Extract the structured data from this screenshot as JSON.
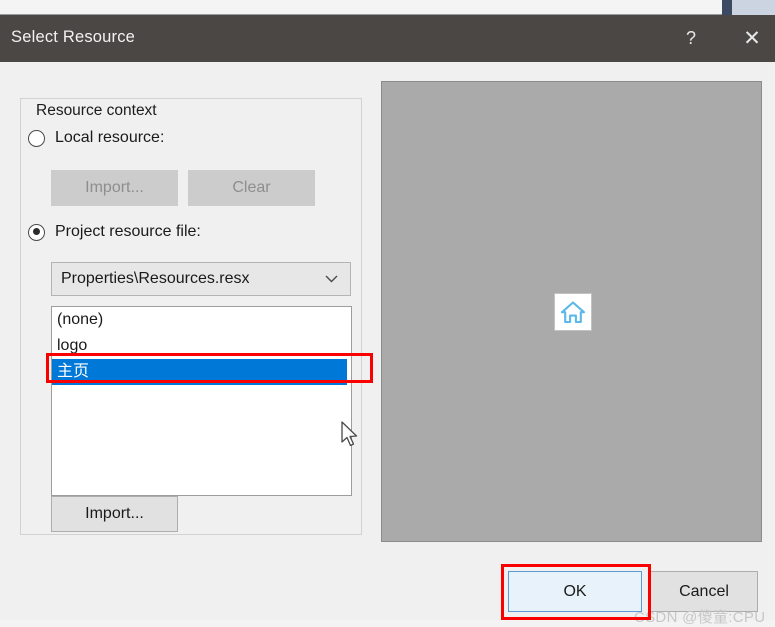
{
  "window": {
    "title": "Select Resource",
    "help_icon": "question-mark-icon",
    "close_icon": "close-x-icon"
  },
  "resource_context": {
    "group_label": "Resource context",
    "options": [
      {
        "label": "Local resource:",
        "selected": false
      },
      {
        "label": "Project resource file:",
        "selected": true
      }
    ],
    "local_buttons": [
      {
        "label": "Import...",
        "enabled": false
      },
      {
        "label": "Clear",
        "enabled": false
      }
    ],
    "combobox": {
      "value": "Properties\\Resources.resx",
      "arrow_icon": "chevron-down-icon"
    },
    "listbox": {
      "items": [
        {
          "label": "(none)",
          "selected": false
        },
        {
          "label": "logo",
          "selected": false
        },
        {
          "label": "主页",
          "selected": true
        }
      ]
    },
    "import_button": {
      "label": "Import..."
    }
  },
  "preview": {
    "image_alt": "home-icon",
    "background_color": "#aaaaaa",
    "icon_color": "#5bb8e8"
  },
  "footer": {
    "ok_label": "OK",
    "cancel_label": "Cancel"
  },
  "annotations": {
    "highlight_color": "#fb0000",
    "targets": [
      "selected-list-item",
      "ok-button"
    ]
  },
  "watermark": {
    "text": "CSDN @傻童:CPU"
  },
  "colors": {
    "titlebar": "#4a4744",
    "dialog_background": "#f0f0f0",
    "selection_blue": "#0078d7",
    "default_button_border": "#5b9bd5"
  }
}
